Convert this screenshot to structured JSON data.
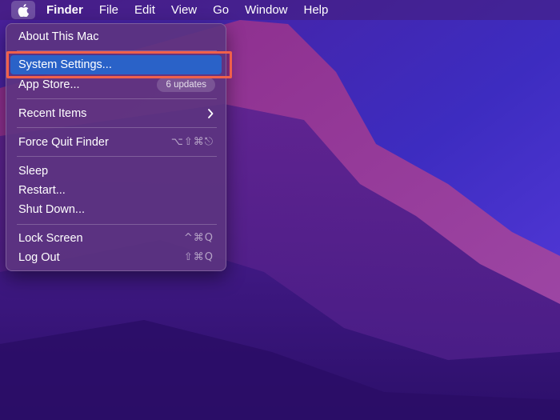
{
  "menubar": {
    "apple_icon": "apple-logo-icon",
    "items": [
      "Finder",
      "File",
      "Edit",
      "View",
      "Go",
      "Window",
      "Help"
    ]
  },
  "apple_menu": {
    "about": "About This Mac",
    "system_settings": "System Settings...",
    "app_store": "App Store...",
    "app_store_badge": "6 updates",
    "recent_items": "Recent Items",
    "recent_items_icon": "chevron-right-icon",
    "force_quit": "Force Quit Finder",
    "force_quit_shortcut": "⌥⇧⌘⎋",
    "sleep": "Sleep",
    "restart": "Restart...",
    "shut_down": "Shut Down...",
    "lock_screen": "Lock Screen",
    "lock_screen_shortcut": "^⌘Q",
    "log_out": "Log Out",
    "log_out_shortcut": "⇧⌘Q"
  },
  "colors": {
    "highlight": "#2a62c8",
    "annotation_box": "#f0604a",
    "wallpaper_base": "#3a1577"
  }
}
